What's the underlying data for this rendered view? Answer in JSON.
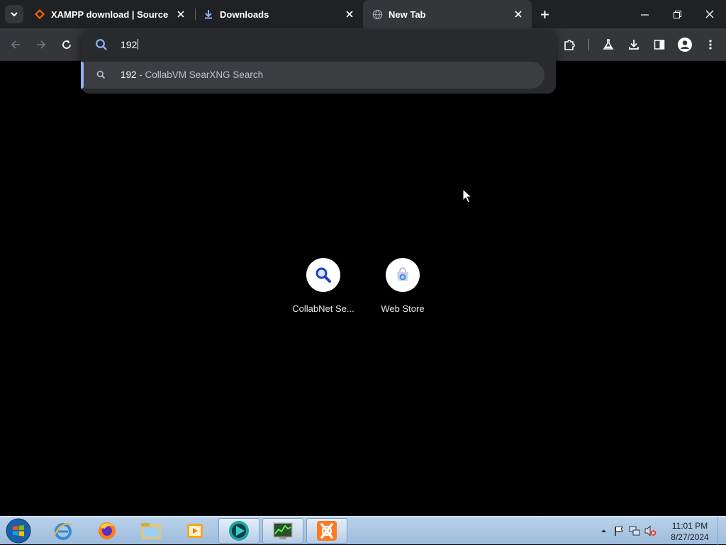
{
  "tabs": [
    {
      "title": "XAMPP download | SourceForge",
      "icon": "sourceforge-icon"
    },
    {
      "title": "Downloads",
      "icon": "download-icon"
    },
    {
      "title": "New Tab",
      "icon": "globe-icon",
      "active": true
    }
  ],
  "omnibox": {
    "value": "192",
    "suggestion": {
      "query": "192",
      "separator": " - ",
      "description": "CollabVM SearXNG Search"
    }
  },
  "shortcuts": [
    {
      "label": "CollabNet Se...",
      "icon": "search-icon"
    },
    {
      "label": "Web Store",
      "icon": "web-store-icon"
    }
  ],
  "taskbar": {
    "apps": [
      "internet-explorer-icon",
      "firefox-icon",
      "file-explorer-icon",
      "media-player-icon",
      "chrome-icon",
      "task-manager-icon",
      "xampp-icon"
    ]
  },
  "clock": {
    "time": "11:01 PM",
    "date": "8/27/2024"
  },
  "colors": {
    "accent": "#8ab4f8",
    "tab_strip": "#202124",
    "toolbar": "#35363a"
  }
}
